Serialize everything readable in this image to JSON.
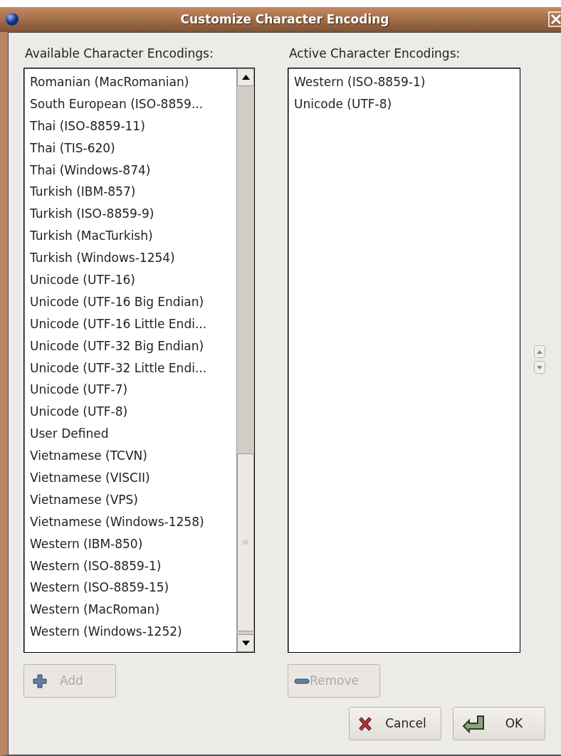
{
  "window": {
    "title": "Customize Character Encoding"
  },
  "available": {
    "label": "Available Character Encodings:",
    "items": [
      {
        "text": "Romanian (MacRomanian)",
        "selected": false
      },
      {
        "text": "South European (ISO-8859...",
        "selected": false
      },
      {
        "text": "Thai (ISO-8859-11)",
        "selected": false
      },
      {
        "text": "Thai (TIS-620)",
        "selected": false
      },
      {
        "text": "Thai (Windows-874)",
        "selected": false
      },
      {
        "text": "Turkish (IBM-857)",
        "selected": false
      },
      {
        "text": "Turkish (ISO-8859-9)",
        "selected": false
      },
      {
        "text": "Turkish (MacTurkish)",
        "selected": false
      },
      {
        "text": "Turkish (Windows-1254)",
        "selected": false
      },
      {
        "text": "Unicode (UTF-16)",
        "selected": false
      },
      {
        "text": "Unicode (UTF-16 Big Endian)",
        "selected": false
      },
      {
        "text": "Unicode (UTF-16 Little Endi...",
        "selected": false
      },
      {
        "text": "Unicode (UTF-32 Big Endian)",
        "selected": false
      },
      {
        "text": "Unicode (UTF-32 Little Endi...",
        "selected": false
      },
      {
        "text": "Unicode (UTF-7)",
        "selected": false
      },
      {
        "text": "Unicode (UTF-8)",
        "selected": false
      },
      {
        "text": "User Defined",
        "selected": false
      },
      {
        "text": "Vietnamese (TCVN)",
        "selected": false
      },
      {
        "text": "Vietnamese (VISCII)",
        "selected": false
      },
      {
        "text": "Vietnamese (VPS)",
        "selected": false
      },
      {
        "text": "Vietnamese (Windows-1258)",
        "selected": false
      },
      {
        "text": "Western (IBM-850)",
        "selected": false
      },
      {
        "text": "Western (ISO-8859-1)",
        "selected": false
      },
      {
        "text": "Western (ISO-8859-15)",
        "selected": false
      },
      {
        "text": "Western (MacRoman)",
        "selected": false
      },
      {
        "text": "Western (Windows-1252)",
        "selected": false
      }
    ],
    "button": {
      "label": "Add",
      "disabled": true
    }
  },
  "active": {
    "label": "Active Character Encodings:",
    "items": [
      {
        "text": "Western (ISO-8859-1)",
        "selected": false
      },
      {
        "text": "Unicode (UTF-8)",
        "selected": false
      }
    ],
    "button": {
      "label": "Remove",
      "disabled": true
    }
  },
  "buttons": [
    {
      "label": "Cancel",
      "kind": "cancel"
    },
    {
      "label": "OK",
      "kind": "ok"
    }
  ]
}
